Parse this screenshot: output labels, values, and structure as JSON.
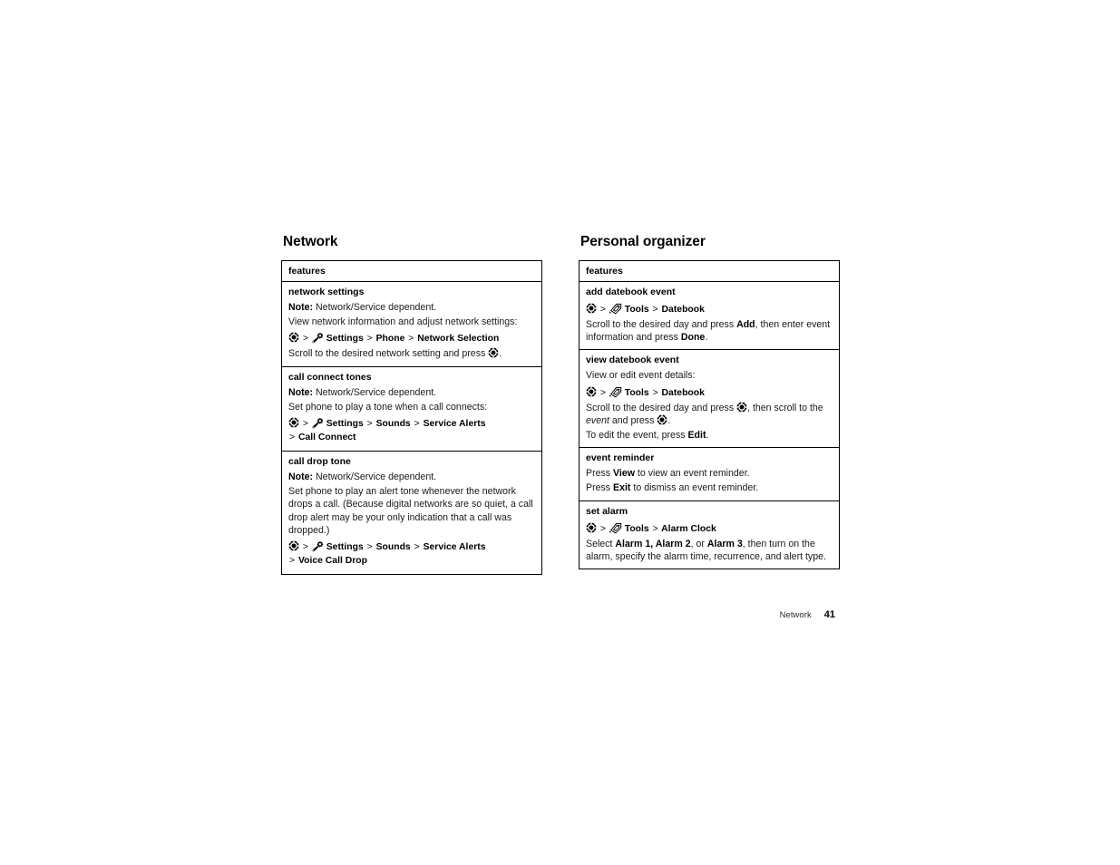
{
  "page": {
    "footer_label": "Network",
    "footer_number": "41"
  },
  "icons": {
    "center_key": "center-select-key-icon",
    "settings": "settings-menu-icon",
    "tools": "tools-menu-icon"
  },
  "columns": [
    {
      "title": "Network",
      "table": {
        "header": "features",
        "rows": [
          {
            "name": "network settings",
            "blocks": [
              {
                "type": "note",
                "label": "Note:",
                "text": " Network/Service dependent."
              },
              {
                "type": "text",
                "text": "View network information and adjust network settings:"
              },
              {
                "type": "path",
                "icon": "center_key",
                "items": [
                  "Settings",
                  "Phone",
                  "Network Selection"
                ],
                "icon2": "settings",
                "icon2_after": 0,
                "wrap_after": null
              },
              {
                "type": "text_with_icon",
                "pre": "Scroll to the desired network setting and press ",
                "icon": "center_key",
                "post": "."
              }
            ]
          },
          {
            "name": "call connect tones",
            "blocks": [
              {
                "type": "note",
                "label": "Note:",
                "text": " Network/Service dependent."
              },
              {
                "type": "text",
                "text": "Set phone to play a tone when a call connects:"
              },
              {
                "type": "path",
                "icon": "center_key",
                "items": [
                  "Settings",
                  "Sounds",
                  "Service Alerts",
                  "Call Connect"
                ],
                "icon2": "settings",
                "icon2_after": 0,
                "wrap_after": 2
              }
            ]
          },
          {
            "name": "call drop tone",
            "blocks": [
              {
                "type": "note",
                "label": "Note:",
                "text": " Network/Service dependent."
              },
              {
                "type": "text",
                "text": "Set phone to play an alert tone whenever the network drops a call. (Because digital networks are so quiet, a call drop alert may be your only indication that a call was dropped.)"
              },
              {
                "type": "path",
                "icon": "center_key",
                "items": [
                  "Settings",
                  "Sounds",
                  "Service Alerts",
                  "Voice Call Drop"
                ],
                "icon2": "settings",
                "icon2_after": 0,
                "wrap_after": 2
              }
            ]
          }
        ]
      }
    },
    {
      "title": "Personal organizer",
      "table": {
        "header": "features",
        "rows": [
          {
            "name": "add datebook event",
            "blocks": [
              {
                "type": "path",
                "icon": "center_key",
                "items": [
                  "Tools",
                  "Datebook"
                ],
                "icon2": "tools",
                "icon2_after": 0,
                "wrap_after": null
              },
              {
                "type": "rich",
                "parts": [
                  {
                    "t": "Scroll to the desired day and press "
                  },
                  {
                    "t": "Add",
                    "b": true
                  },
                  {
                    "t": ", then enter event information and press "
                  },
                  {
                    "t": "Done",
                    "b": true
                  },
                  {
                    "t": "."
                  }
                ]
              }
            ]
          },
          {
            "name": "view datebook event",
            "blocks": [
              {
                "type": "text",
                "text": "View or edit event details:"
              },
              {
                "type": "path",
                "icon": "center_key",
                "items": [
                  "Tools",
                  "Datebook"
                ],
                "icon2": "tools",
                "icon2_after": 0,
                "wrap_after": null
              },
              {
                "type": "rich",
                "parts": [
                  {
                    "t": "Scroll to the desired day and press "
                  },
                  {
                    "icon": "center_key"
                  },
                  {
                    "t": ", then scroll to the "
                  },
                  {
                    "t": "event",
                    "i": true
                  },
                  {
                    "t": " and press "
                  },
                  {
                    "icon": "center_key"
                  },
                  {
                    "t": "."
                  }
                ]
              },
              {
                "type": "rich",
                "parts": [
                  {
                    "t": "To edit the event, press "
                  },
                  {
                    "t": "Edit",
                    "b": true
                  },
                  {
                    "t": "."
                  }
                ]
              }
            ]
          },
          {
            "name": "event reminder",
            "blocks": [
              {
                "type": "rich",
                "parts": [
                  {
                    "t": "Press "
                  },
                  {
                    "t": "View",
                    "b": true
                  },
                  {
                    "t": " to view an event reminder."
                  }
                ]
              },
              {
                "type": "rich",
                "parts": [
                  {
                    "t": "Press "
                  },
                  {
                    "t": "Exit",
                    "b": true
                  },
                  {
                    "t": " to dismiss an event reminder."
                  }
                ]
              }
            ]
          },
          {
            "name": "set alarm",
            "blocks": [
              {
                "type": "path",
                "icon": "center_key",
                "items": [
                  "Tools",
                  "Alarm Clock"
                ],
                "icon2": "tools",
                "icon2_after": 0,
                "wrap_after": null
              },
              {
                "type": "rich",
                "parts": [
                  {
                    "t": "Select "
                  },
                  {
                    "t": "Alarm 1, Alarm 2",
                    "b": true
                  },
                  {
                    "t": ", or "
                  },
                  {
                    "t": "Alarm 3",
                    "b": true
                  },
                  {
                    "t": ", then turn on the alarm, specify the alarm time, recurrence, and alert type."
                  }
                ]
              }
            ]
          }
        ]
      }
    }
  ]
}
